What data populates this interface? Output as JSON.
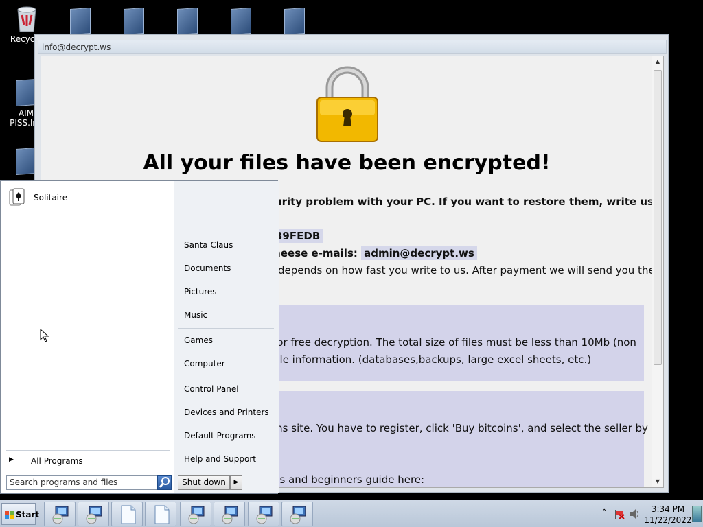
{
  "desktop": {
    "icons": [
      {
        "label": "Recycle"
      },
      {
        "label": "AIM\nPISS.lnk"
      }
    ]
  },
  "ransom_window": {
    "title": "info@decrypt.ws",
    "headline": "All your files have been encrypted!",
    "line1": "curity problem with your PC. If you want to restore them, write us to",
    "id_fragment": "39FEDB",
    "line2_prefix": "theese e-mails:",
    "email": "admin@decrypt.ws",
    "line3": "e depends on how fast you write to us. After payment we will send you the",
    "block1_line1": "for free decryption. The total size of files must be less than 10Mb (non",
    "block1_line2": "ble information. (databases,backups, large excel sheets, etc.)",
    "block2_line1": "ins site. You have to register, click 'Buy bitcoins', and select the seller by",
    "block2_line2": "ns and beginners guide here:"
  },
  "start_menu": {
    "pinned": [
      "Solitaire"
    ],
    "all_programs": "All Programs",
    "search_placeholder": "Search programs and files",
    "shutdown": "Shut down",
    "right_items": [
      "Santa Claus",
      "Documents",
      "Pictures",
      "Music",
      "Games",
      "Computer",
      "Control Panel",
      "Devices and Printers",
      "Default Programs",
      "Help and Support"
    ]
  },
  "taskbar": {
    "start_label": "Start",
    "clock_time": "3:34 PM",
    "clock_date": "11/22/2022"
  },
  "colors": {
    "accent": "#d3d3ea",
    "lock_gold": "#f2b800"
  }
}
